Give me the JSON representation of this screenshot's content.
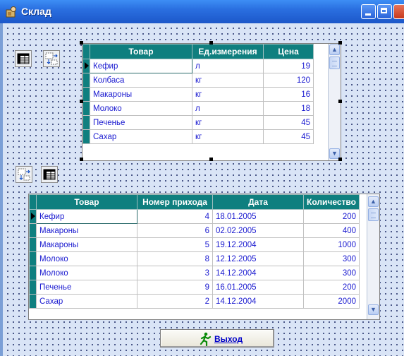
{
  "window": {
    "title": "Склад"
  },
  "goods_table": {
    "columns": [
      "Товар",
      "Ед.измерения",
      "Цена"
    ],
    "rows": [
      [
        "Кефир",
        "л",
        "19"
      ],
      [
        "Колбаса",
        "кг",
        "120"
      ],
      [
        "Макароны",
        "кг",
        "16"
      ],
      [
        "Молоко",
        "л",
        "18"
      ],
      [
        "Печенье",
        "кг",
        "45"
      ],
      [
        "Сахар",
        "кг",
        "45"
      ]
    ]
  },
  "arrivals_table": {
    "columns": [
      "Товар",
      "Номер прихода",
      "Дата",
      "Количество"
    ],
    "rows": [
      [
        "Кефир",
        "4",
        "18.01.2005",
        "200"
      ],
      [
        "Макароны",
        "6",
        "02.02.2005",
        "400"
      ],
      [
        "Макароны",
        "5",
        "19.12.2004",
        "1000"
      ],
      [
        "Молоко",
        "8",
        "12.12.2005",
        "300"
      ],
      [
        "Молоко",
        "3",
        "14.12.2004",
        "300"
      ],
      [
        "Печенье",
        "9",
        "16.01.2005",
        "200"
      ],
      [
        "Сахар",
        "2",
        "14.12.2004",
        "2000"
      ]
    ]
  },
  "exit_button": {
    "label": "Выход",
    "icon": "running-man-icon"
  },
  "icons": {
    "table_view": "table-view-icon",
    "table_move": "table-move-icon"
  },
  "colors": {
    "header_bg": "#0f7f7f",
    "cell_text": "#1a1ad0",
    "titlebar": "#2a6fe0"
  }
}
